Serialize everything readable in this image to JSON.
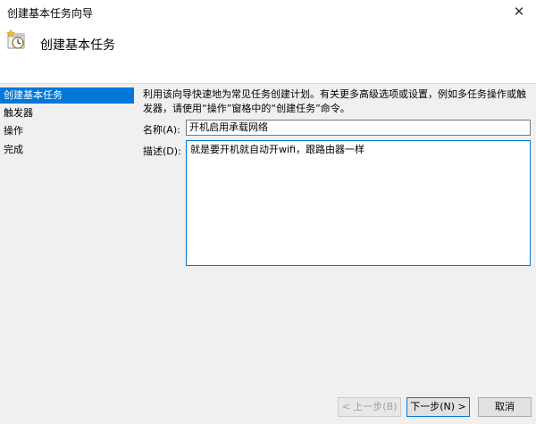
{
  "window": {
    "title": "创建基本任务向导",
    "close_glyph": "✕"
  },
  "header": {
    "title": "创建基本任务",
    "icon": "task-clock-icon"
  },
  "steps": [
    {
      "label": "创建基本任务",
      "active": true
    },
    {
      "label": "触发器",
      "active": false
    },
    {
      "label": "操作",
      "active": false
    },
    {
      "label": "完成",
      "active": false
    }
  ],
  "content": {
    "intro": "利用该向导快速地为常见任务创建计划。有关更多高级选项或设置，例如多任务操作或触发器，请使用“操作”窗格中的“创建任务”命令。",
    "name_label": "名称(A):",
    "name_value": "开机启用承载网络",
    "description_label": "描述(D):",
    "description_value": "就是要开机就自动开wifi，跟路由器一样"
  },
  "buttons": {
    "back": "< 上一步(B)",
    "next": "下一步(N) >",
    "cancel": "取消"
  },
  "colors": {
    "accent": "#0078d7",
    "panel_bg": "#f0f0f0"
  }
}
